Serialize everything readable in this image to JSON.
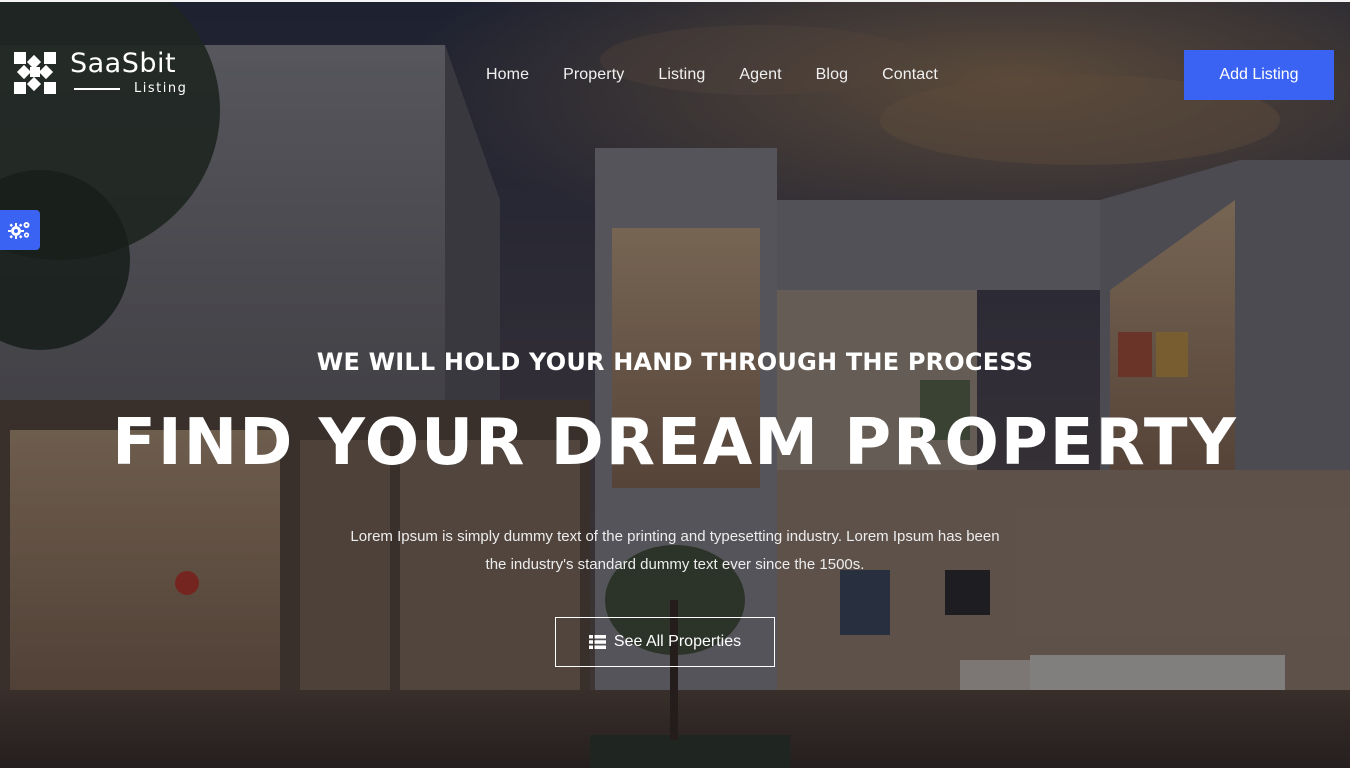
{
  "brand": {
    "name": "SaaSbit",
    "tagline": "Listing"
  },
  "nav": {
    "items": [
      {
        "label": "Home"
      },
      {
        "label": "Property"
      },
      {
        "label": "Listing"
      },
      {
        "label": "Agent"
      },
      {
        "label": "Blog"
      },
      {
        "label": "Contact"
      }
    ]
  },
  "header": {
    "cta_label": "Add Listing"
  },
  "settings": {
    "icon": "gears-icon"
  },
  "hero": {
    "kicker": "WE WILL HOLD YOUR HAND THROUGH THE PROCESS",
    "headline": "FIND YOUR DREAM PROPERTY",
    "lead": "Lorem Ipsum is simply dummy text of the printing and typesetting industry. Lorem Ipsum has been the industry's standard dummy text ever since the 1500s.",
    "button_label": "See All Properties",
    "button_icon": "list-icon"
  },
  "colors": {
    "accent": "#3b63f3",
    "text": "#ffffff"
  }
}
